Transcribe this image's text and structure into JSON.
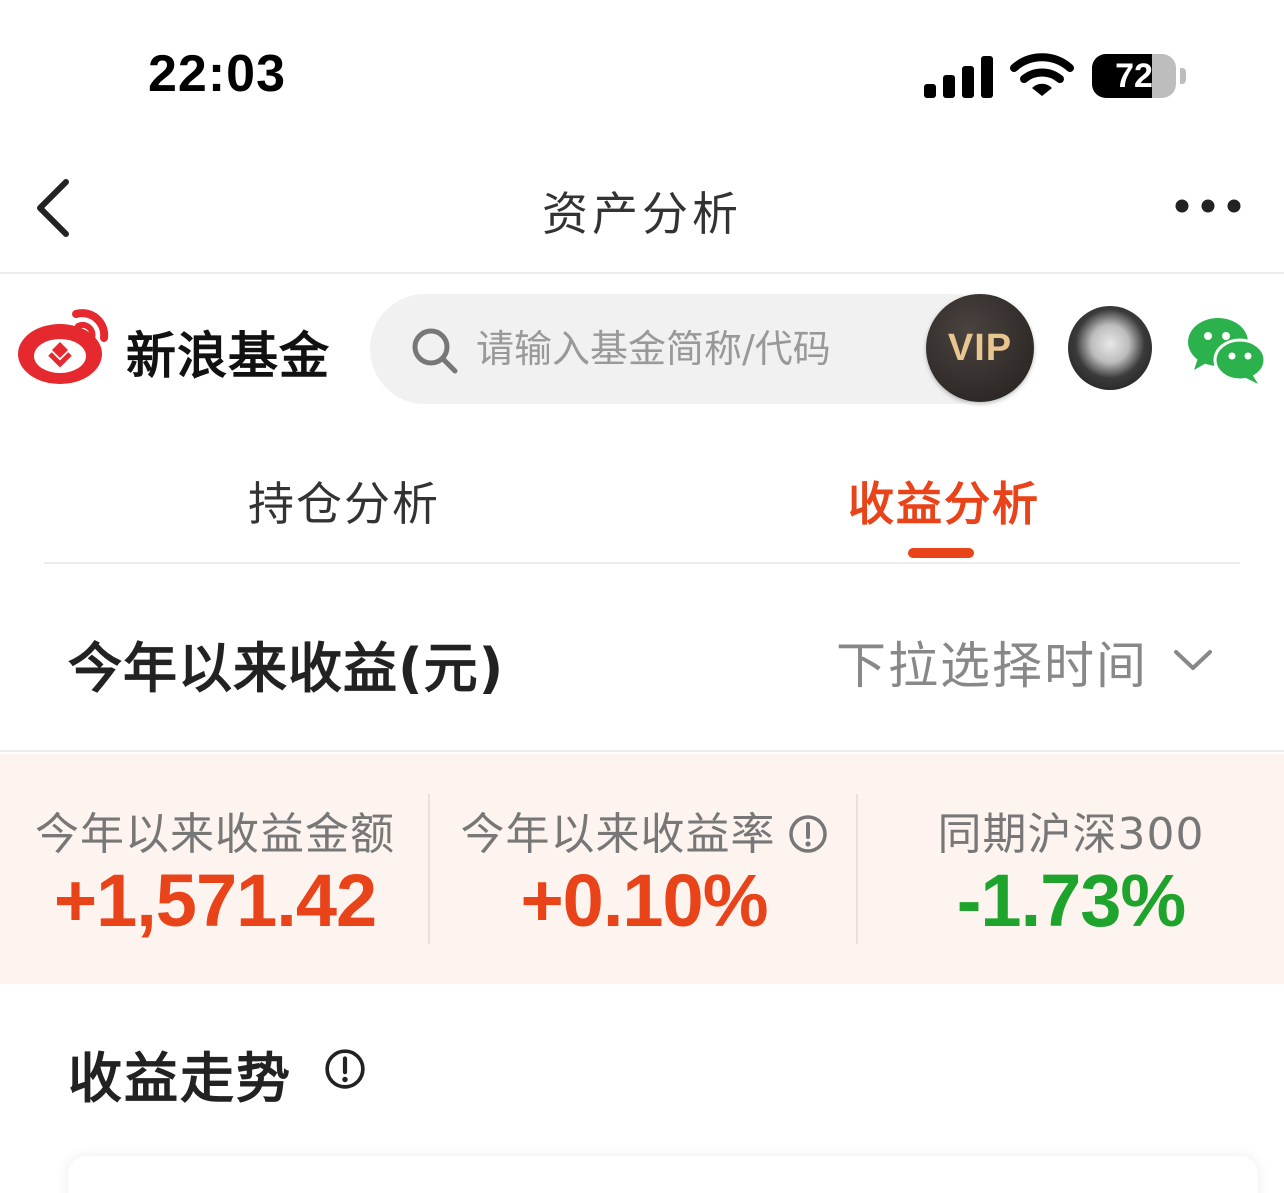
{
  "status_bar": {
    "time": "22:03",
    "battery_percent": 72,
    "battery_label": "72"
  },
  "nav": {
    "title": "资产分析",
    "back_icon": "chevron-left-icon",
    "more_icon": "more-horizontal-icon"
  },
  "brand": {
    "name": "新浪基金",
    "search_placeholder": "请输入基金简称/代码",
    "vip_label": "VIP",
    "icons": [
      "weibo-logo",
      "search-icon",
      "avatar",
      "wechat-icon"
    ]
  },
  "tabs": [
    {
      "label": "持仓分析",
      "active": false
    },
    {
      "label": "收益分析",
      "active": true
    }
  ],
  "period": {
    "title": "今年以来收益(元)",
    "select_label": "下拉选择时间"
  },
  "metrics": [
    {
      "label": "今年以来收益金额",
      "value": "+1,571.42",
      "trend": "up"
    },
    {
      "label": "今年以来收益率",
      "value": "+0.10%",
      "trend": "up"
    },
    {
      "label": "同期沪深300",
      "value": "-1.73%",
      "trend": "down"
    }
  ],
  "trend": {
    "title": "收益走势"
  },
  "colors": {
    "accent": "#e9431a",
    "positive": "#e9431a",
    "negative": "#1ea42d",
    "metrics_bg": "#fdf4ef"
  }
}
